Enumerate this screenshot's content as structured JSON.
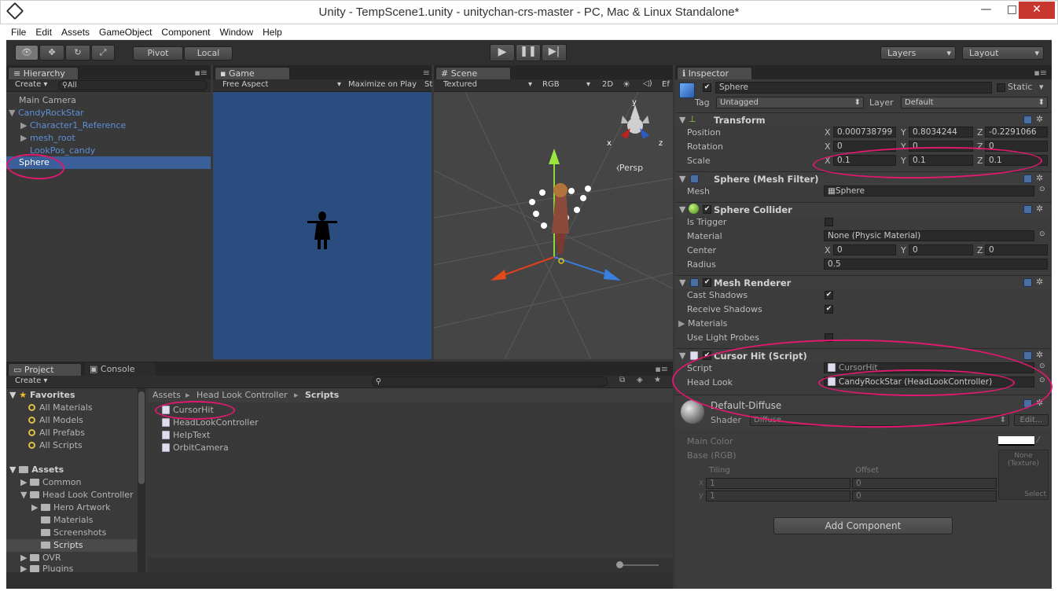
{
  "window": {
    "title": "Unity - TempScene1.unity - unitychan-crs-master - PC, Mac & Linux Standalone*",
    "min": "—",
    "max": "□",
    "close": "✕"
  },
  "menu": [
    "File",
    "Edit",
    "Assets",
    "GameObject",
    "Component",
    "Window",
    "Help"
  ],
  "toolbar": {
    "pivot": "Pivot",
    "local": "Local",
    "layers": "Layers",
    "layout": "Layout"
  },
  "hierarchy": {
    "tab": "Hierarchy",
    "create": "Create ▾",
    "search_placeholder": "All",
    "items": [
      "Main Camera",
      "CandyRockStar",
      "Character1_Reference",
      "mesh_root",
      "LookPos_candy",
      "Sphere"
    ]
  },
  "game": {
    "tab": "Game",
    "aspect": "Free Aspect",
    "maximize": "Maximize on Play",
    "stats": "St"
  },
  "scene": {
    "tab": "Scene",
    "shading": "Textured",
    "rgb": "RGB",
    "mode2d": "2D",
    "persp": "Persp",
    "effects": "Ef",
    "axis_y": "y",
    "axis_x": "x",
    "axis_z": "z"
  },
  "project": {
    "tab": "Project",
    "console_tab": "Console",
    "create": "Create ▾",
    "favorites_label": "Favorites",
    "favorites": [
      "All Materials",
      "All Models",
      "All Prefabs",
      "All Scripts"
    ],
    "assets_label": "Assets",
    "assets": [
      "Common",
      "Head Look Controller",
      "Hero Artwork",
      "Materials",
      "Screenshots",
      "Scripts",
      "OVR",
      "Plugins"
    ],
    "breadcrumb": [
      "Assets",
      "Head Look Controller",
      "Scripts"
    ],
    "files": [
      "CursorHit",
      "HeadLookController",
      "HelpText",
      "OrbitCamera"
    ]
  },
  "inspector": {
    "tab": "Inspector",
    "object_name": "Sphere",
    "static": "Static",
    "tag_label": "Tag",
    "tag": "Untagged",
    "layer_label": "Layer",
    "layer": "Default",
    "transform": {
      "title": "Transform",
      "position_label": "Position",
      "position": [
        "0.000738799",
        "0.8034244",
        "-0.2291066"
      ],
      "rotation_label": "Rotation",
      "rotation": [
        "0",
        "0",
        "0"
      ],
      "scale_label": "Scale",
      "scale": [
        "0.1",
        "0.1",
        "0.1"
      ]
    },
    "mesh_filter": {
      "title": "Sphere (Mesh Filter)",
      "mesh_label": "Mesh",
      "mesh": "Sphere"
    },
    "collider": {
      "title": "Sphere Collider",
      "trigger_label": "Is Trigger",
      "material_label": "Material",
      "material": "None (Physic Material)",
      "center_label": "Center",
      "center": [
        "0",
        "0",
        "0"
      ],
      "radius_label": "Radius",
      "radius": "0.5"
    },
    "renderer": {
      "title": "Mesh Renderer",
      "cast_label": "Cast Shadows",
      "receive_label": "Receive Shadows",
      "materials_label": "Materials",
      "probes_label": "Use Light Probes"
    },
    "cursor_hit": {
      "title": "Cursor Hit (Script)",
      "script_label": "Script",
      "script": "CursorHit",
      "head_label": "Head Look",
      "head": "CandyRockStar (HeadLookController)"
    },
    "material": {
      "name": "Default-Diffuse",
      "shader_label": "Shader",
      "shader": "Diffuse",
      "edit": "Edit...",
      "main_color": "Main Color",
      "base_rgb": "Base (RGB)",
      "tiling": "Tiling",
      "offset": "Offset",
      "x_label": "x",
      "y_label": "y",
      "tile_x": "1",
      "tile_y": "1",
      "off_x": "0",
      "off_y": "0",
      "texture": "None\n(Texture)",
      "select": "Select"
    },
    "add_component": "Add Component"
  },
  "colors": {
    "accent_annotation": "#e0186f",
    "selection": "#3b5f99",
    "game_bg": "#2b4c7e"
  }
}
